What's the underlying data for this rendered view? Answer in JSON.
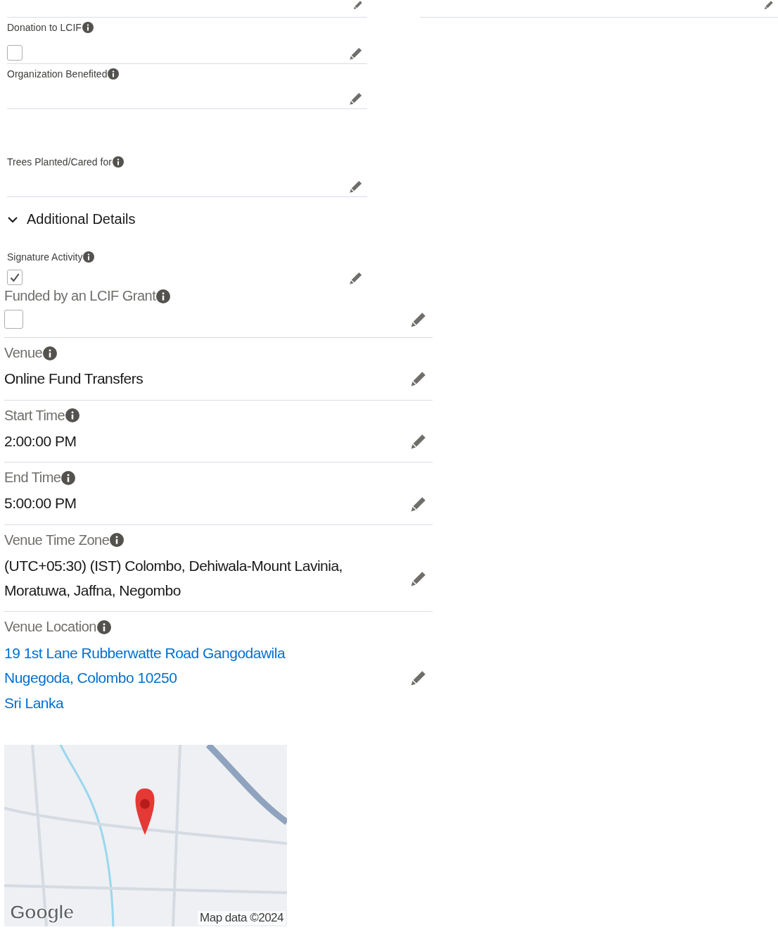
{
  "compact_groups": [
    [
      {
        "label": "Donation to LCIF",
        "kind": "checkbox",
        "checked": false
      },
      {
        "label": "Organization Benefited",
        "kind": "text"
      }
    ],
    [
      {
        "label": "Trees Planted/Cared for",
        "kind": "text"
      }
    ]
  ],
  "section": {
    "title": "Additional Details",
    "expanded": true
  },
  "signature": {
    "label": "Signature Activity",
    "kind": "checkbox",
    "checked": true
  },
  "fields": [
    {
      "label": "Funded by an LCIF Grant",
      "kind": "checkbox",
      "checked": false
    },
    {
      "label": "Venue",
      "kind": "text",
      "value": "Online Fund Transfers"
    },
    {
      "label": "Start Time",
      "kind": "text",
      "value": "2:00:00 PM"
    },
    {
      "label": "End Time",
      "kind": "text",
      "value": "5:00:00 PM"
    },
    {
      "label": "Venue Time Zone",
      "kind": "text",
      "value": "(UTC+05:30) (IST) Colombo, Dehiwala-Mount Lavinia, Moratuwa, Jaffna, Negombo"
    },
    {
      "label": "Venue Location",
      "kind": "address",
      "lines": [
        "19 1st Lane Rubberwatte Road Gangodawila",
        "Nugegoda, Colombo 10250",
        "Sri Lanka"
      ]
    }
  ],
  "map": {
    "logo": "Google",
    "attribution": "Map data ©2024"
  }
}
